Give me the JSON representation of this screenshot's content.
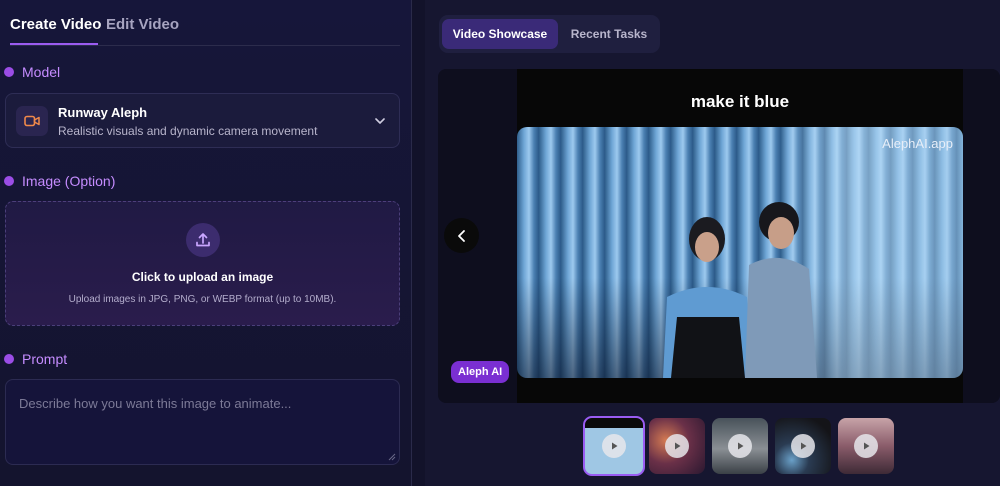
{
  "tabs": {
    "create_video": "Create Video",
    "edit_video": "Edit Video"
  },
  "model": {
    "section_label": "Model",
    "name": "Runway Aleph",
    "description": "Realistic visuals and dynamic camera movement",
    "icon": "video-camera-icon"
  },
  "image": {
    "section_label": "Image (Option)",
    "upload_title": "Click to upload an image",
    "upload_subtitle": "Upload images in JPG, PNG, or WEBP format (up to 10MB).",
    "icon": "upload-icon"
  },
  "prompt": {
    "section_label": "Prompt",
    "placeholder": "Describe how you want this image to animate..."
  },
  "showcase": {
    "segments": {
      "active": "Video Showcase",
      "inactive": "Recent Tasks"
    },
    "caption": "make it blue",
    "watermark": "AlephAI.app",
    "badge": "Aleph AI",
    "thumbnails": [
      {
        "label": "thumb-1",
        "active": true
      },
      {
        "label": "thumb-2",
        "active": false
      },
      {
        "label": "thumb-3",
        "active": false
      },
      {
        "label": "thumb-4",
        "active": false
      },
      {
        "label": "thumb-5",
        "active": false
      }
    ]
  },
  "colors": {
    "accent": "#9b5cf0",
    "section_label": "#c58cff",
    "badge": "#7a2fd2",
    "bg": "#12122a"
  }
}
